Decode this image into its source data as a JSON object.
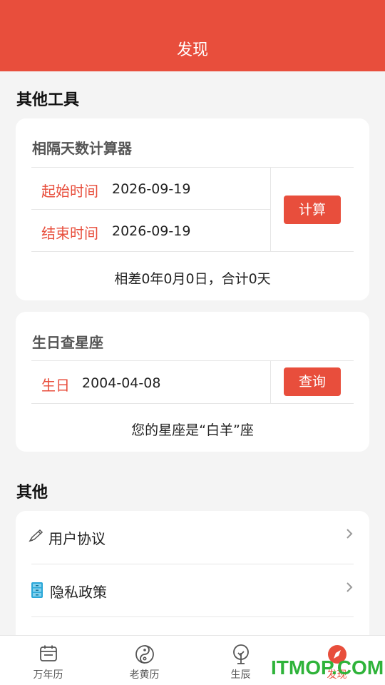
{
  "header": {
    "title": "发现"
  },
  "sections": {
    "tools_title": "其他工具",
    "other_title": "其他"
  },
  "days_calculator": {
    "title": "相隔天数计算器",
    "start_label": "起始时间",
    "start_value": "2026-09-19",
    "end_label": "结束时间",
    "end_value": "2026-09-19",
    "button": "计算",
    "result": "相差0年0月0日，合计0天"
  },
  "zodiac": {
    "title": "生日查星座",
    "birthday_label": "生日",
    "birthday_value": "2004-04-08",
    "button": "查询",
    "result": "您的星座是“白羊”座"
  },
  "other_list": [
    {
      "icon": "pencil-icon",
      "label": "用户协议"
    },
    {
      "icon": "cabinet-icon",
      "label": "隐私政策"
    }
  ],
  "tabbar": [
    {
      "label": "万年历",
      "icon": "calendar-icon"
    },
    {
      "label": "老黄历",
      "icon": "yin-yang-icon"
    },
    {
      "label": "生辰",
      "icon": "tree-icon"
    },
    {
      "label": "发现",
      "icon": "compass-icon",
      "active": true
    }
  ],
  "watermark": "ITMOP.COM",
  "colors": {
    "accent": "#e84e3c",
    "watermark": "#2fb33a"
  }
}
